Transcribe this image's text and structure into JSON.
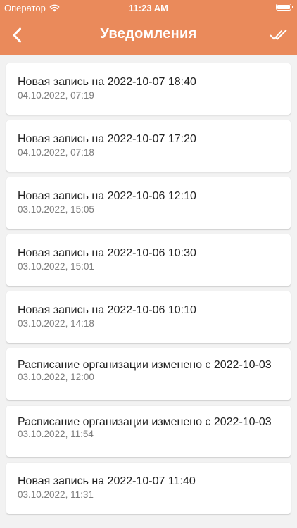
{
  "status_bar": {
    "carrier": "Оператор",
    "time": "11:23 AM"
  },
  "header": {
    "title": "Уведомления",
    "back_icon": "chevron-left-icon",
    "action_icon": "double-check-icon",
    "background": "#ea8a5b"
  },
  "notifications": [
    {
      "title": "Новая запись на 2022-10-07 18:40",
      "date": "04.10.2022, 07:19"
    },
    {
      "title": "Новая запись на 2022-10-07 17:20",
      "date": "04.10.2022, 07:18"
    },
    {
      "title": "Новая запись на 2022-10-06 12:10",
      "date": "03.10.2022, 15:05"
    },
    {
      "title": "Новая запись на 2022-10-06 10:30",
      "date": "03.10.2022, 15:01"
    },
    {
      "title": "Новая запись на 2022-10-06 10:10",
      "date": "03.10.2022, 14:18"
    },
    {
      "title": "Расписание организации изменено с 2022-10-03",
      "date": "03.10.2022, 12:00"
    },
    {
      "title": "Расписание организации изменено с 2022-10-03",
      "date": "03.10.2022, 11:54"
    },
    {
      "title": "Новая запись на 2022-10-07 11:40",
      "date": "03.10.2022, 11:31"
    }
  ]
}
